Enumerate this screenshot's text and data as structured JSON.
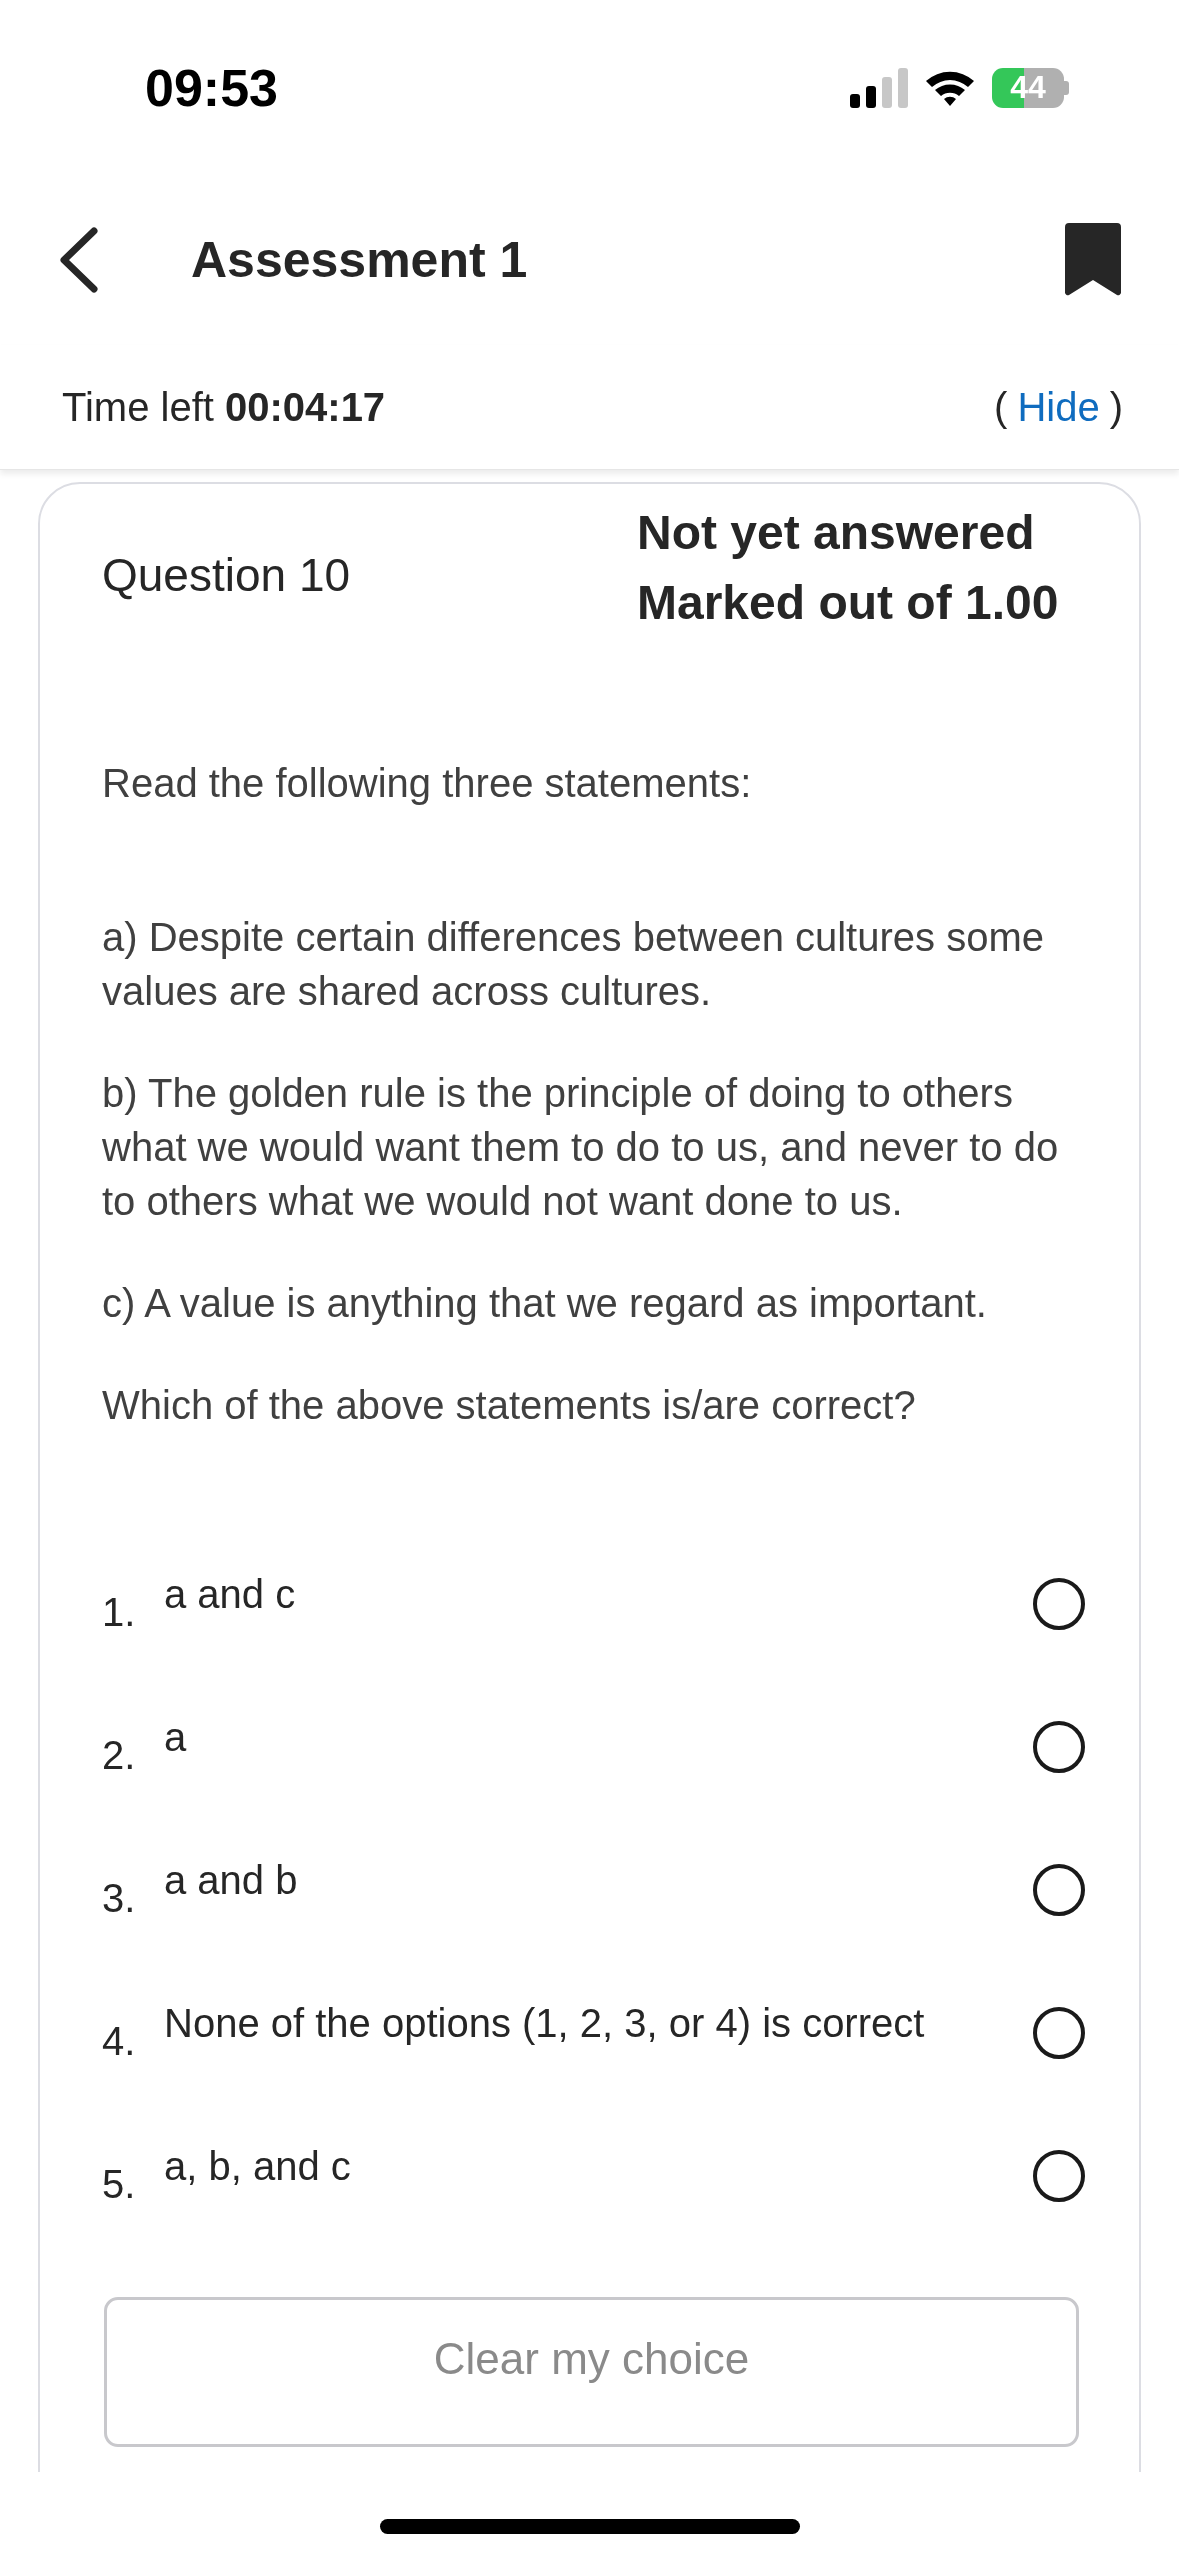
{
  "status_bar": {
    "time": "09:53",
    "battery": "44"
  },
  "header": {
    "title": "Assessment 1"
  },
  "timer": {
    "label": "Time left",
    "value": "00:04:17",
    "toggle_open": "(",
    "toggle": "Hide",
    "toggle_close": ")"
  },
  "question": {
    "number": "Question 10",
    "status": "Not yet answered",
    "marks": "Marked out of 1.00",
    "paragraphs": [
      "Read the following three statements:",
      "a) Despite certain differences between cultures some values are shared across cultures.",
      "b) The golden rule is the principle of doing to others what we would want them to do to us, and never to do to others what we would not want done to us.",
      "c) A value is anything that we regard as important.",
      "Which of the above statements is/are correct?"
    ],
    "options": [
      {
        "number": "1.",
        "label": "a and c",
        "selected": false
      },
      {
        "number": "2.",
        "label": "a",
        "selected": false
      },
      {
        "number": "3.",
        "label": "a and b",
        "selected": false
      },
      {
        "number": "4.",
        "label": "None of the options (1, 2, 3, or 4) is correct",
        "selected": false
      },
      {
        "number": "5.",
        "label": "a, b, and c",
        "selected": false
      }
    ],
    "clear_button": "Clear my choice"
  }
}
